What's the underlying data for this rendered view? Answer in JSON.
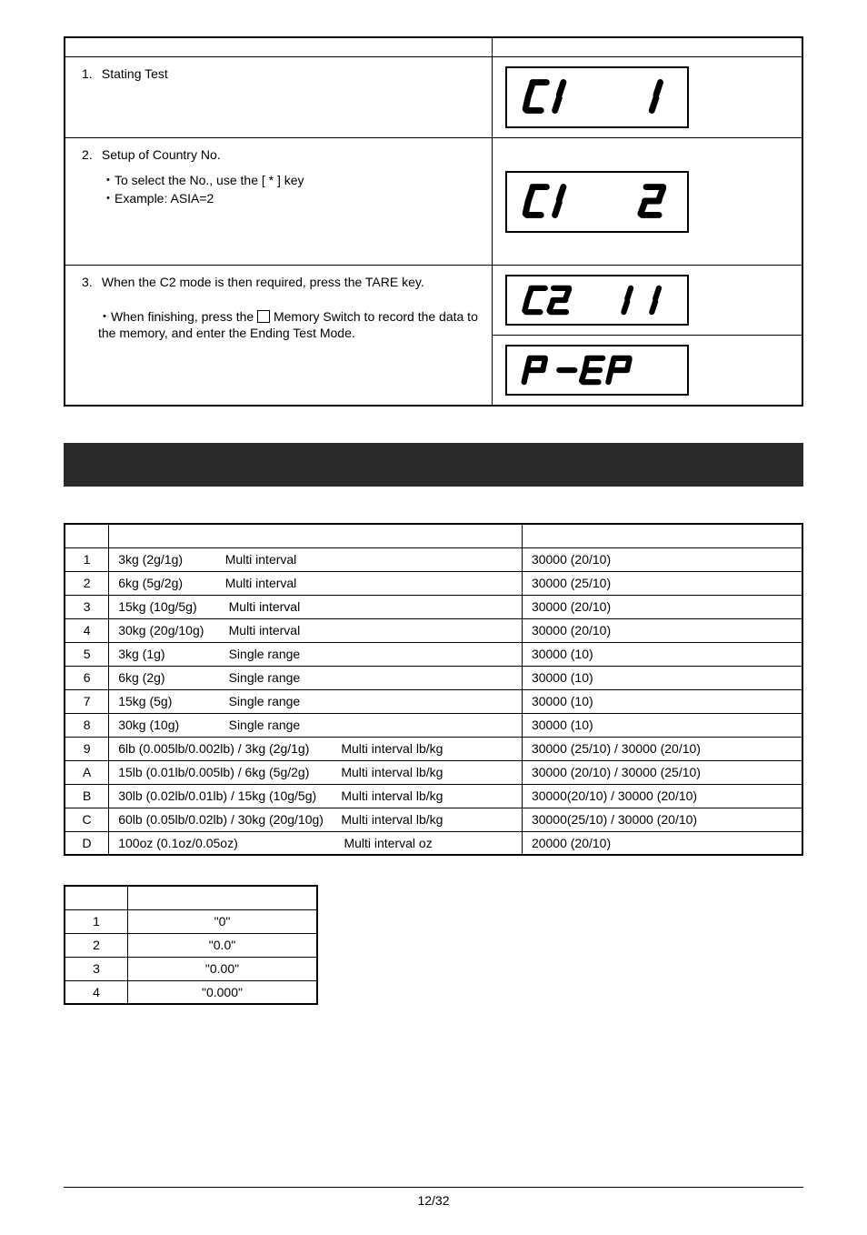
{
  "procedure": {
    "row1": {
      "num": "1.",
      "label": "Stating Test"
    },
    "row2": {
      "num": "2.",
      "label": "Setup of Country No.",
      "sub1": "・To select the No., use the [ * ] key",
      "sub2": "・Example: ASIA=2"
    },
    "row3": {
      "num": "3.",
      "label": "When the C2 mode is then required, press the TARE key."
    },
    "row4": {
      "sub_prefix": "・When finishing, press the ",
      "sub_suffix": " Memory Switch to record the data to the memory, and enter the Ending Test Mode."
    }
  },
  "main_rows": [
    {
      "id": "1",
      "desc": "3kg (2g/1g)            Multi interval",
      "val": "30000 (20/10)"
    },
    {
      "id": "2",
      "desc": "6kg (5g/2g)            Multi interval",
      "val": "30000 (25/10)"
    },
    {
      "id": "3",
      "desc": "15kg (10g/5g)         Multi interval",
      "val": "30000 (20/10)"
    },
    {
      "id": "4",
      "desc": "30kg (20g/10g)       Multi interval",
      "val": "30000 (20/10)"
    },
    {
      "id": "5",
      "desc": "3kg (1g)                  Single range",
      "val": "30000 (10)"
    },
    {
      "id": "6",
      "desc": "6kg (2g)                  Single range",
      "val": "30000 (10)"
    },
    {
      "id": "7",
      "desc": "15kg (5g)                Single range",
      "val": "30000 (10)"
    },
    {
      "id": "8",
      "desc": "30kg (10g)              Single range",
      "val": "30000 (10)"
    },
    {
      "id": "9",
      "desc": "6lb (0.005lb/0.002lb) / 3kg (2g/1g)         Multi interval lb/kg",
      "val": "30000 (25/10) / 30000 (20/10)"
    },
    {
      "id": "A",
      "desc": "15lb (0.01lb/0.005lb) / 6kg (5g/2g)         Multi interval lb/kg",
      "val": "30000 (20/10) / 30000 (25/10)"
    },
    {
      "id": "B",
      "desc": "30lb (0.02lb/0.01lb) / 15kg (10g/5g)       Multi interval lb/kg",
      "val": "30000(20/10) / 30000 (20/10)"
    },
    {
      "id": "C",
      "desc": "60lb (0.05lb/0.02lb) / 30kg (20g/10g)     Multi interval lb/kg",
      "val": "30000(25/10) / 30000 (20/10)"
    },
    {
      "id": "D",
      "desc": "100oz (0.1oz/0.05oz)                              Multi interval oz",
      "val": "20000 (20/10)"
    }
  ],
  "small_rows": [
    {
      "id": "1",
      "val": "\"0\""
    },
    {
      "id": "2",
      "val": "\"0.0\""
    },
    {
      "id": "3",
      "val": "\"0.00\""
    },
    {
      "id": "4",
      "val": "\"0.000\""
    }
  ],
  "footer": "12/32"
}
